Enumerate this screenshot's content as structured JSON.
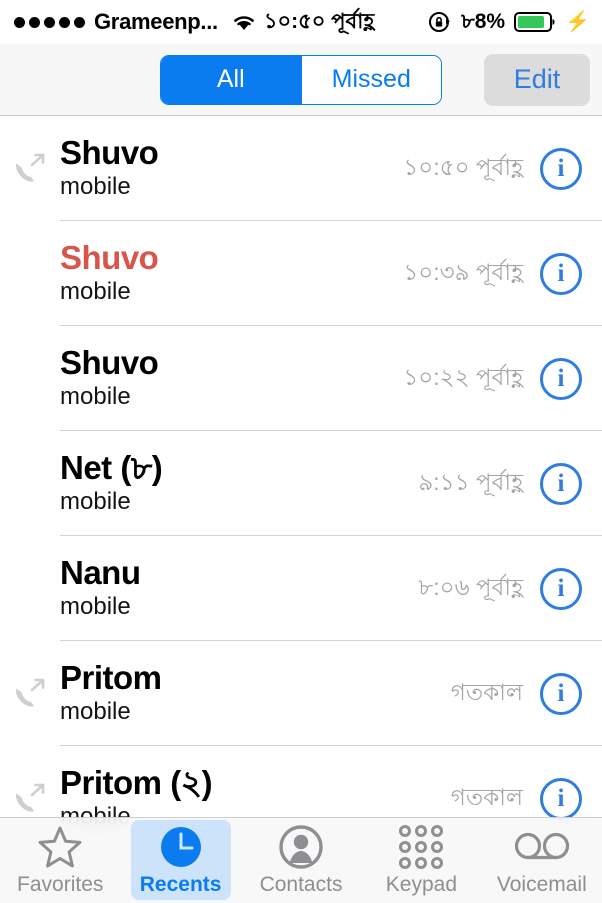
{
  "status_bar": {
    "signal_dots": 5,
    "carrier": "Grameenp...",
    "wifi_icon": "wifi-icon",
    "time": "১০:৫০ পূর্বাহ্ণ",
    "rotation_lock_icon": "rotation-lock-icon",
    "battery_percent": "৮8%",
    "battery_level": 80,
    "charging_bolt": "⚡",
    "battery_color": "#34c759"
  },
  "nav_bar": {
    "segments": [
      {
        "label": "All",
        "selected": true
      },
      {
        "label": "Missed",
        "selected": false
      }
    ],
    "edit_label": "Edit",
    "accent_color": "#0a7cf0"
  },
  "call_list": {
    "rows": [
      {
        "name": "Shuvo",
        "count": "",
        "label": "mobile",
        "time": "১০:৫০ পূর্বাহ্ণ",
        "type": "outgoing",
        "missed": false
      },
      {
        "name": "Shuvo",
        "count": "",
        "label": "mobile",
        "time": "১০:৩৯ পূর্বাহ্ণ",
        "type": "none",
        "missed": true
      },
      {
        "name": "Shuvo",
        "count": "",
        "label": "mobile",
        "time": "১০:২২ পূর্বাহ্ণ",
        "type": "none",
        "missed": false
      },
      {
        "name": "Net",
        "count": "(৮)",
        "label": "mobile",
        "time": "৯:১১ পূর্বাহ্ণ",
        "type": "none",
        "missed": false
      },
      {
        "name": "Nanu",
        "count": "",
        "label": "mobile",
        "time": "৮:০৬ পূর্বাহ্ণ",
        "type": "none",
        "missed": false
      },
      {
        "name": "Pritom",
        "count": "",
        "label": "mobile",
        "time": "গতকাল",
        "type": "outgoing",
        "missed": false
      },
      {
        "name": "Pritom",
        "count": "(২)",
        "label": "mobile",
        "time": "গতকাল",
        "type": "outgoing",
        "missed": false
      }
    ],
    "info_glyph": "i",
    "missed_color": "#d9544a",
    "info_color": "#2f7de1"
  },
  "tab_bar": {
    "tabs": [
      {
        "label": "Favorites",
        "icon": "star-icon",
        "selected": false
      },
      {
        "label": "Recents",
        "icon": "clock-icon",
        "selected": true
      },
      {
        "label": "Contacts",
        "icon": "person-icon",
        "selected": false
      },
      {
        "label": "Keypad",
        "icon": "keypad-icon",
        "selected": false
      },
      {
        "label": "Voicemail",
        "icon": "voicemail-icon",
        "selected": false
      }
    ],
    "selected_color": "#0a7cf0",
    "inactive_color": "#8e8e93"
  }
}
